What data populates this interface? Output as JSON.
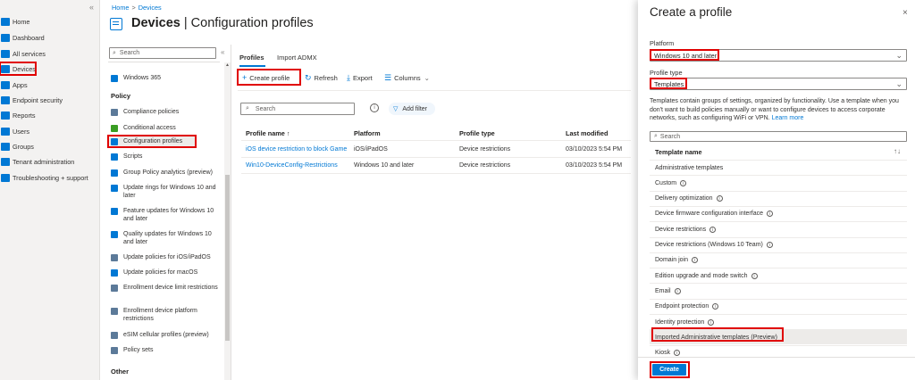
{
  "leftnav": {
    "items": [
      {
        "label": "Home",
        "icon": "home-icon",
        "color": "#0078d4"
      },
      {
        "label": "Dashboard",
        "icon": "dashboard-icon",
        "color": "#0078d4"
      },
      {
        "label": "All services",
        "icon": "all-services-icon",
        "color": "#0078d4"
      },
      {
        "label": "Devices",
        "icon": "devices-icon",
        "color": "#0078d4"
      },
      {
        "label": "Apps",
        "icon": "apps-icon",
        "color": "#0078d4"
      },
      {
        "label": "Endpoint security",
        "icon": "endpoint-security-icon",
        "color": "#0078d4"
      },
      {
        "label": "Reports",
        "icon": "reports-icon",
        "color": "#0078d4"
      },
      {
        "label": "Users",
        "icon": "users-icon",
        "color": "#0078d4"
      },
      {
        "label": "Groups",
        "icon": "groups-icon",
        "color": "#0078d4"
      },
      {
        "label": "Tenant administration",
        "icon": "tenant-admin-icon",
        "color": "#0078d4"
      },
      {
        "label": "Troubleshooting + support",
        "icon": "troubleshooting-icon",
        "color": "#0078d4"
      }
    ],
    "collapse_glyph": "«"
  },
  "breadcrumb": {
    "home": "Home",
    "sep": ">",
    "devices": "Devices"
  },
  "page": {
    "title_bold": "Devices",
    "title_rest": " | Configuration profiles",
    "more": "···"
  },
  "submenu": {
    "search_placeholder": "Search",
    "collapse_glyph": "«",
    "windows365": "Windows 365",
    "policy_header": "Policy",
    "other_header": "Other",
    "items": [
      {
        "label": "Compliance policies",
        "color": "#5c7a99"
      },
      {
        "label": "Conditional access",
        "color": "#3a9d23"
      },
      {
        "label": "Configuration profiles",
        "color": "#0078d4"
      },
      {
        "label": "Scripts",
        "color": "#0078d4"
      },
      {
        "label": "Group Policy analytics (preview)",
        "color": "#0078d4"
      },
      {
        "label": "Update rings for Windows 10 and later",
        "color": "#0078d4"
      },
      {
        "label": "Feature updates for Windows 10 and later",
        "color": "#0078d4"
      },
      {
        "label": "Quality updates for Windows 10 and later",
        "color": "#0078d4"
      },
      {
        "label": "Update policies for iOS/iPadOS",
        "color": "#5c7a99"
      },
      {
        "label": "Update policies for macOS",
        "color": "#0078d4"
      },
      {
        "label": "Enrollment device limit restrictions",
        "color": "#5c7a99"
      },
      {
        "label": "Enrollment device platform restrictions",
        "color": "#5c7a99"
      },
      {
        "label": "eSIM cellular profiles (preview)",
        "color": "#5c7a99"
      },
      {
        "label": "Policy sets",
        "color": "#5c7a99"
      }
    ]
  },
  "tabs": {
    "profiles": "Profiles",
    "import": "Import ADMX"
  },
  "toolbar": {
    "create": "Create profile",
    "refresh": "Refresh",
    "export": "Export",
    "columns": "Columns"
  },
  "filter": {
    "search_placeholder": "Search",
    "add_filter": "Add filter",
    "info": "i"
  },
  "table": {
    "headers": {
      "name": "Profile name ↑",
      "platform": "Platform",
      "type": "Profile type",
      "modified": "Last modified"
    },
    "rows": [
      {
        "name": "iOS device restriction to block Game",
        "platform": "iOS/iPadOS",
        "type": "Device restrictions",
        "modified": "03/10/2023 5:54 PM"
      },
      {
        "name": "Win10-DeviceConfig-Restrictions",
        "platform": "Windows 10 and later",
        "type": "Device restrictions",
        "modified": "03/10/2023 5:54 PM"
      }
    ]
  },
  "panel": {
    "title": "Create a profile",
    "close": "×",
    "platform_label": "Platform",
    "platform_value": "Windows 10 and later",
    "profile_type_label": "Profile type",
    "profile_type_value": "Templates",
    "desc": "Templates contain groups of settings, organized by functionality. Use a template when you don't want to build policies manually or want to configure devices to access corporate networks, such as configuring WiFi or VPN.",
    "desc_link": "Learn more",
    "search_placeholder": "Search",
    "template_header": "Template name",
    "sort_glyph": "↑↓",
    "templates": [
      {
        "label": "Administrative templates",
        "info": false
      },
      {
        "label": "Custom",
        "info": true
      },
      {
        "label": "Delivery optimization",
        "info": true
      },
      {
        "label": "Device firmware configuration interface",
        "info": true
      },
      {
        "label": "Device restrictions",
        "info": true
      },
      {
        "label": "Device restrictions (Windows 10 Team)",
        "info": true
      },
      {
        "label": "Domain join",
        "info": true
      },
      {
        "label": "Edition upgrade and mode switch",
        "info": true
      },
      {
        "label": "Email",
        "info": true
      },
      {
        "label": "Endpoint protection",
        "info": true
      },
      {
        "label": "Identity protection",
        "info": true
      },
      {
        "label": "Imported Administrative templates (Preview)",
        "info": false
      },
      {
        "label": "Kiosk",
        "info": true
      }
    ],
    "create_button": "Create"
  }
}
